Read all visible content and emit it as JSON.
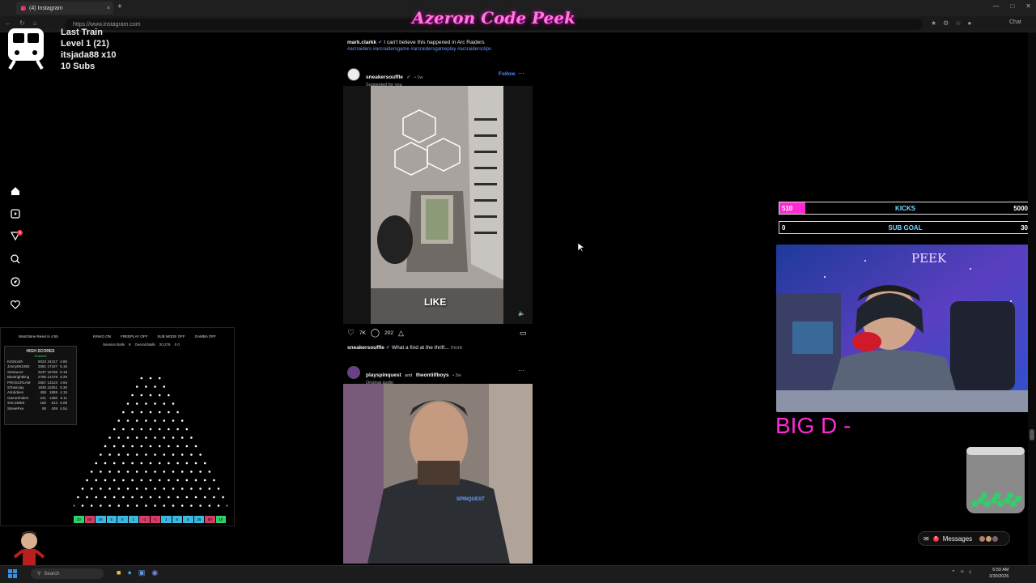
{
  "browser": {
    "tab_title": "(4) Instagram",
    "tab_close": "×",
    "new_tab": "+",
    "url": "https://www.instagram.com",
    "chat_label": "Chat"
  },
  "stream": {
    "title": "Azeron Code Peek"
  },
  "train": {
    "line1": "Last Train",
    "line2": "Level 1  (21)",
    "line3": "itsjada88 x10",
    "line4": "10 Subs"
  },
  "sidebar": {
    "notification_count": "4",
    "icons": [
      "home-icon",
      "reels-icon",
      "send-icon",
      "search-icon",
      "explore-icon",
      "heart-icon"
    ]
  },
  "feed": {
    "post0": {
      "username": "mark.clarkk",
      "caption": "I can't believe this happened in Arc Raiders",
      "hashtags": "#arcraiders #arcraidersgame #arcraidersgameplay #arcraidersclips"
    },
    "post1": {
      "username": "sneakersouffle",
      "time": "• 1w",
      "sub": "Suggested for you",
      "follow": "Follow",
      "more": "···",
      "overlay_text": "LIKE",
      "likes": "7K",
      "comments": "202",
      "caption_user": "sneakersouffle",
      "caption": "What a find at the thrift...",
      "caption_more": "more"
    },
    "post2": {
      "username": "playspinquest",
      "and": "and",
      "username2": "theontilfboys",
      "time": "• 3w",
      "sub": "Original audio",
      "more": "···",
      "shirt_text": "SPINQUEST"
    }
  },
  "plinko": {
    "header_left": "Watchtime Reset in 4:55",
    "toggles": [
      "KINKO ON",
      "FREEPLAY OFF",
      "SUB MODE OFF",
      "GAMBA OFF"
    ],
    "session_balls_label": "Session Balls",
    "session_balls": "9",
    "overall_balls_label": "Overall Balls",
    "overall_balls": "20,276",
    "extra": "0  0",
    "high_scores_title": "HIGH SCORES",
    "high_scores_sub": "Channel",
    "high_scores": [
      [
        "Kritztooth",
        "5022",
        "24417",
        "4.86"
      ],
      [
        "Jonny8S1982",
        "3381",
        "17427",
        "5.15"
      ],
      [
        "SwSaLaV",
        "3237",
        "16766",
        "5.18"
      ],
      [
        "Bluetrightking",
        "2785",
        "14478",
        "5.20"
      ],
      [
        "PROSCR1AM",
        "2657",
        "13123",
        "4.94"
      ],
      [
        "STownJay",
        "1935",
        "10251",
        "5.30"
      ],
      [
        "Arkoldees",
        "458",
        "1869",
        "4.15"
      ],
      [
        "GameShaker",
        "221",
        "1350",
        "6.11"
      ],
      [
        "SHLSMEE",
        "160",
        "813",
        "5.08"
      ],
      [
        "SteviePxe",
        "90",
        "409",
        "4.54"
      ]
    ],
    "slots": [
      "10",
      "50",
      "25",
      "5",
      "5",
      "1",
      "-1",
      "-1",
      "1",
      "5",
      "5",
      "25",
      "50",
      "10"
    ]
  },
  "goals": {
    "kicks": {
      "current": "510",
      "label": "KICKS",
      "target": "5000",
      "progress": 0.102
    },
    "subs": {
      "current": "0",
      "label": "SUB GOAL",
      "target": "30",
      "progress": 0
    }
  },
  "webcam": {
    "label": "PEEK"
  },
  "bottom_text": "BIG D -",
  "messages": {
    "label": "Messages",
    "badge": "9"
  },
  "taskbar": {
    "search_placeholder": "Search",
    "time": "6:59 AM",
    "date": "3/30/2026"
  },
  "colors": {
    "accent_pink": "#ff2ad4",
    "goal_text_blue": "#7ad7ff",
    "instagram_blue": "#4a90ff"
  }
}
